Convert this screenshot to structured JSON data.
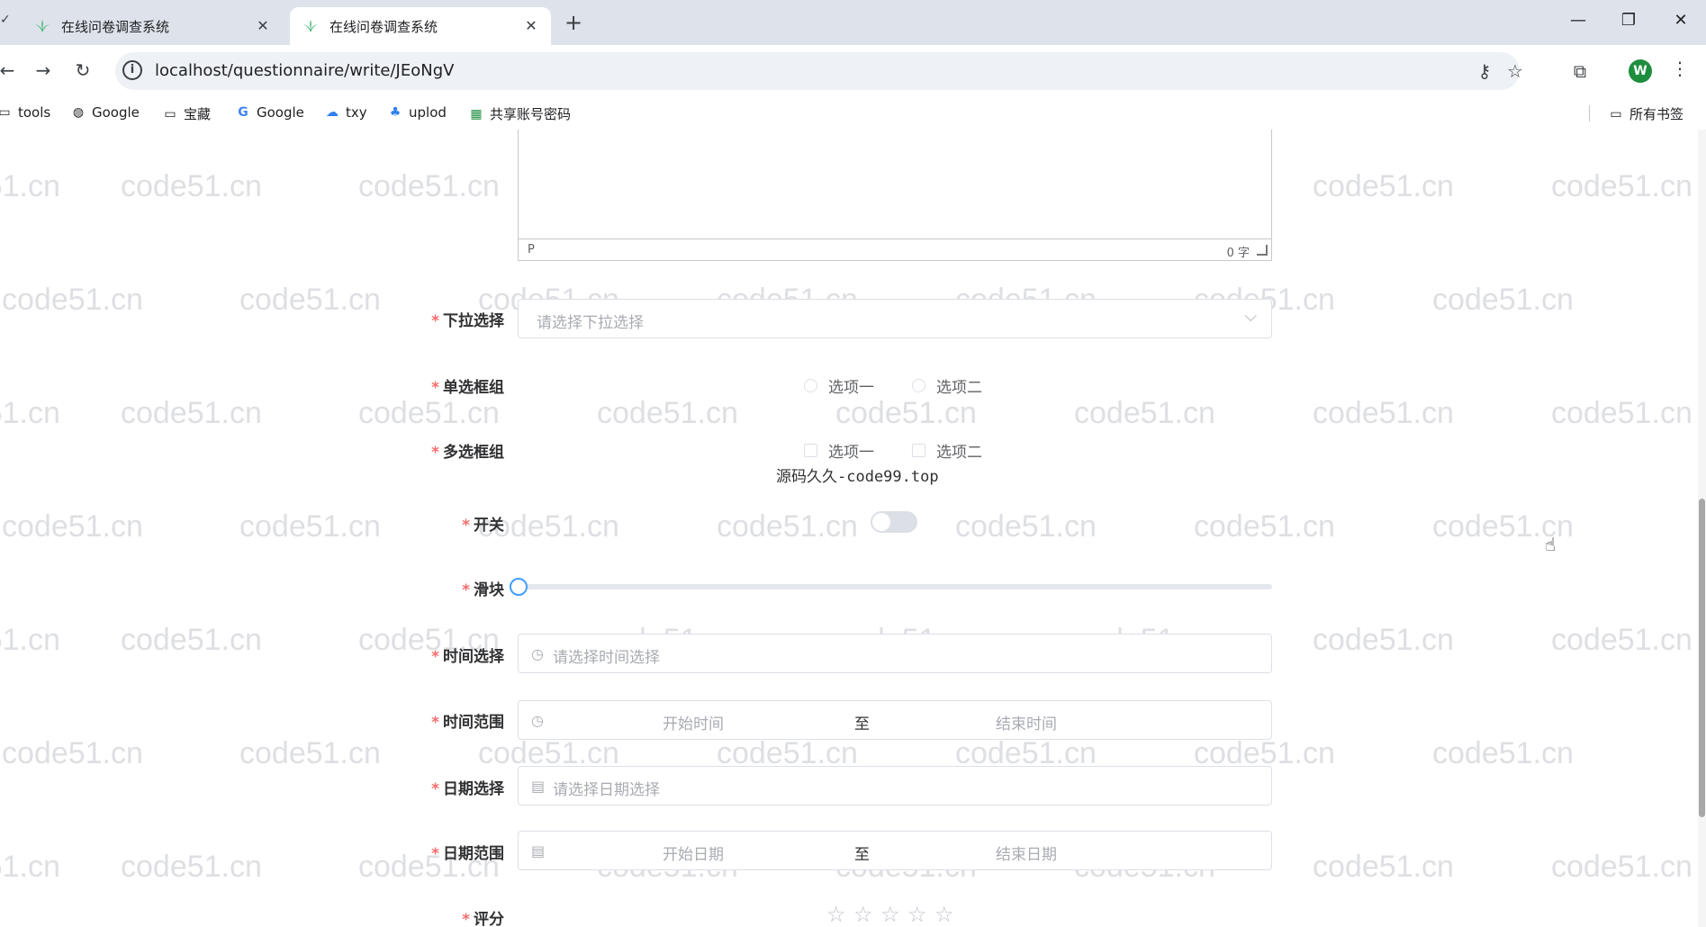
{
  "browser": {
    "tabs": [
      {
        "title": "在线问卷调查系统",
        "active": false
      },
      {
        "title": "在线问卷调查系统",
        "active": true
      }
    ],
    "url": "localhost/questionnaire/write/JEoNgV",
    "profile_initial": "W",
    "bookmarks": [
      {
        "label": "tools",
        "icon": "folder-icon"
      },
      {
        "label": "Google",
        "icon": "globe-icon"
      },
      {
        "label": "宝藏",
        "icon": "folder-icon"
      },
      {
        "label": "Google",
        "icon": "google-icon"
      },
      {
        "label": "txy",
        "icon": "cloud-icon"
      },
      {
        "label": "uplod",
        "icon": "upload-icon"
      },
      {
        "label": "共享账号密码",
        "icon": "sheet-icon"
      }
    ],
    "all_bookmarks_label": "所有书签"
  },
  "watermark_text": "code51.cn",
  "overlay_text": "源码久久-code99.top",
  "form": {
    "editor": {
      "path": "P",
      "count": "0 字"
    },
    "select": {
      "label": "下拉选择",
      "placeholder": "请选择下拉选择"
    },
    "radio": {
      "label": "单选框组",
      "options": [
        "选项一",
        "选项二"
      ]
    },
    "checkbox": {
      "label": "多选框组",
      "options": [
        "选项一",
        "选项二"
      ]
    },
    "switch": {
      "label": "开关",
      "on": false
    },
    "slider": {
      "label": "滑块",
      "value": 0
    },
    "time": {
      "label": "时间选择",
      "placeholder": "请选择时间选择"
    },
    "time_range": {
      "label": "时间范围",
      "start": "开始时间",
      "sep": "至",
      "end": "结束时间"
    },
    "date": {
      "label": "日期选择",
      "placeholder": "请选择日期选择"
    },
    "date_range": {
      "label": "日期范围",
      "start": "开始日期",
      "sep": "至",
      "end": "结束日期"
    },
    "rate": {
      "label": "评分",
      "max": 5,
      "value": 0
    },
    "required_mark": "*"
  },
  "colors": {
    "required": "#f56c6c",
    "primary": "#409eff",
    "favicon": "#3cb371",
    "avatar": "#1e8e3e"
  }
}
